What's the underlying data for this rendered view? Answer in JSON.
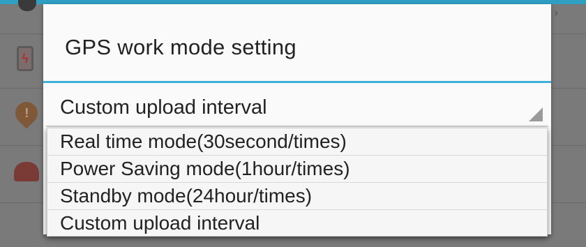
{
  "dialog": {
    "title": "GPS work mode setting",
    "selected_value": "Custom upload interval"
  },
  "dropdown": {
    "options": [
      "Real time mode(30second/times)",
      "Power Saving mode(1hour/times)",
      "Standby mode(24hour/times)",
      "Custom upload interval"
    ]
  },
  "colors": {
    "accent": "#3fb0d8",
    "dialog_bg": "#fafafa",
    "dim_bg": "#7a7a7a"
  },
  "icons": [
    "phone-charging-icon",
    "alert-location-icon",
    "siren-icon",
    "spinner-arrow-icon"
  ]
}
